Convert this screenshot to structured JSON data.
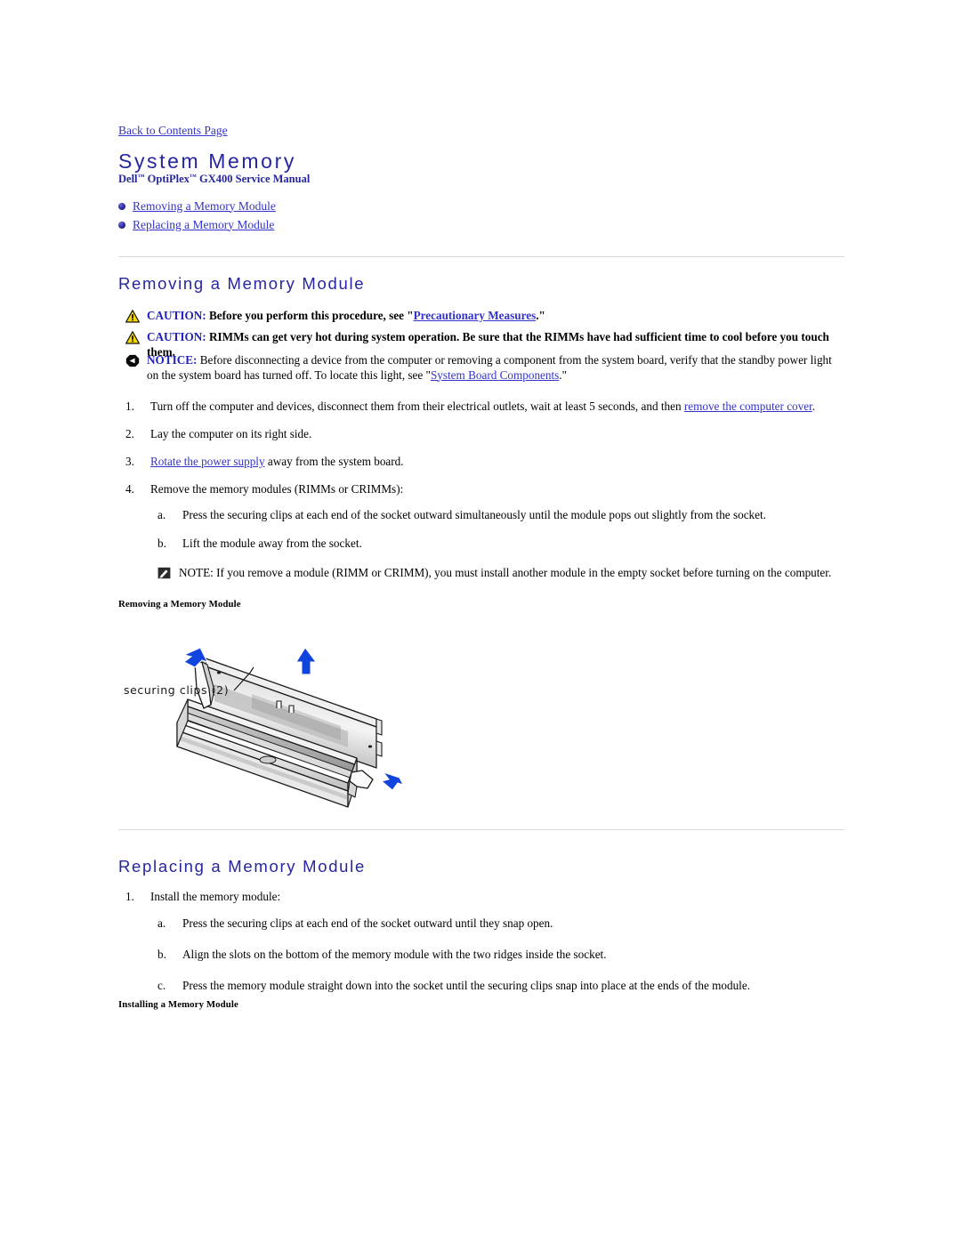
{
  "document": {
    "back_link": "Back to Contents Page",
    "title": "System Memory",
    "subtitle_pre": "Dell",
    "subtitle_tm1": "™",
    "subtitle_mid": " OptiPlex",
    "subtitle_tm2": "™",
    "subtitle_post": " GX400 Service Manual"
  },
  "toc": {
    "items": [
      {
        "label": "Removing a Memory Module"
      },
      {
        "label": "Replacing a Memory Module"
      }
    ]
  },
  "sections": {
    "removing": {
      "heading": "Removing a Memory Module",
      "alerts": [
        {
          "icon": "caution-triangle-icon",
          "keyword": "CAUTION:",
          "text_before": " Before you perform this procedure, see \"",
          "link": "Precautionary Measures",
          "text_after": ".\""
        },
        {
          "icon": "caution-triangle-icon",
          "keyword": "CAUTION:",
          "text_before": " RIMMs can get very hot during system operation. Be sure that the RIMMs have had sufficient time to cool before you touch them.",
          "link": "",
          "text_after": ""
        },
        {
          "icon": "notice-octagon-icon",
          "keyword": "NOTICE:",
          "text_before": " Before disconnecting a device from the computer or removing a component from the system board, verify that the standby power light on the system board has turned off. To locate this light, see \"",
          "link": "System Board Components",
          "text_after": ".\""
        }
      ],
      "steps": [
        {
          "marker": "1.",
          "text_before": "Turn off the computer and devices, disconnect them from their electrical outlets, wait at least 5 seconds, and then ",
          "link": "remove the computer cover",
          "text_after": "."
        },
        {
          "marker": "2.",
          "text_before": "Lay the computer on its right side.",
          "link": "",
          "text_after": ""
        },
        {
          "marker": "3.",
          "text_before": "",
          "link": "Rotate the power supply",
          "text_after": " away from the system board."
        },
        {
          "marker": "4.",
          "text_before": "Remove the memory modules (RIMMs or CRIMMs):",
          "link": "",
          "text_after": ""
        }
      ],
      "substeps": [
        {
          "marker": "a.",
          "text": "Press the securing clips at each end of the socket outward simultaneously until the module pops out slightly from the socket."
        },
        {
          "marker": "b.",
          "text": "Lift the module away from the socket."
        }
      ],
      "note": {
        "icon": "note-pencil-icon",
        "keyword": "NOTE:",
        "text": " If you remove a module (RIMM or CRIMM), you must install another module in the empty socket before turning on the computer."
      },
      "figure": {
        "caption": "Removing a Memory Module",
        "callout": "securing clips (2)",
        "arrow_color": "#1144dd"
      }
    },
    "replacing": {
      "heading": "Replacing a Memory Module",
      "steps": [
        {
          "marker": "1.",
          "text": "Install the memory module:"
        }
      ],
      "substeps": [
        {
          "marker": "a.",
          "text": "Press the securing clips at each end of the socket outward until they snap open."
        },
        {
          "marker": "b.",
          "text": "Align the slots on the bottom of the memory module with the two ridges inside the socket."
        },
        {
          "marker": "c.",
          "text": "Press the memory module straight down into the socket until the securing clips snap into place at the ends of the module."
        }
      ],
      "figure": {
        "caption": "Installing a Memory Module"
      }
    }
  },
  "colors": {
    "heading_blue": "#26269e",
    "link_blue": "#3333cc",
    "keyword_blue": "#2222bb",
    "rule_gray": "#d9d9d9",
    "caution_yellow": "#f5d800"
  }
}
